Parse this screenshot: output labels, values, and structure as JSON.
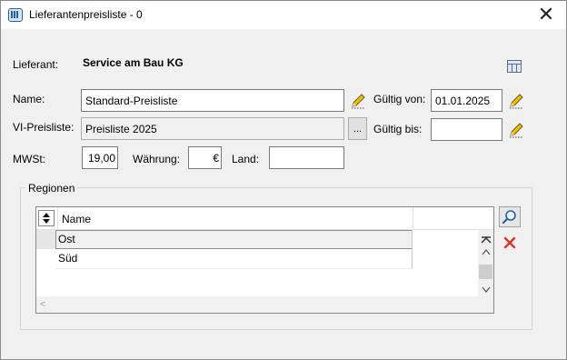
{
  "window": {
    "title": "Lieferantenpreisliste - 0",
    "close_symbol": "✕"
  },
  "form": {
    "lieferant_label": "Lieferant:",
    "lieferant_value": "Service am Bau KG",
    "name_label": "Name:",
    "name_value": "Standard-Preisliste",
    "vi_label": "VI-Preisliste:",
    "vi_value": "Preisliste 2025",
    "vi_button": "...",
    "mwst_label": "MWSt:",
    "mwst_value": "19,00",
    "waehrung_label": "Währung:",
    "waehrung_value": "€",
    "land_label": "Land:",
    "land_value": "",
    "gueltig_von_label": "Gültig von:",
    "gueltig_von_value": "01.01.2025",
    "gueltig_bis_label": "Gültig bis:",
    "gueltig_bis_value": ""
  },
  "regionen": {
    "title": "Regionen",
    "column_header": "Name",
    "rows": [
      "Ost",
      "Süd"
    ],
    "selected_row": 0
  },
  "colors": {
    "accent": "#1f5fa8",
    "delete": "#d9342b",
    "pencil": "#e8b000"
  }
}
